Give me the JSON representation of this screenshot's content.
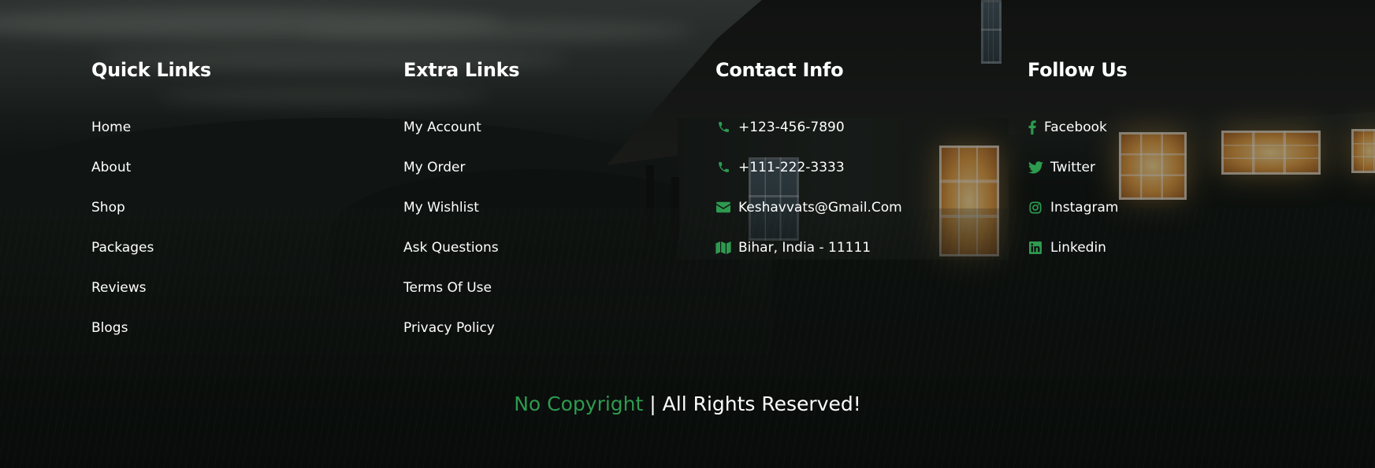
{
  "footer": {
    "quick_links": {
      "title": "Quick Links",
      "items": [
        "Home",
        "About",
        "Shop",
        "Packages",
        "Reviews",
        "Blogs"
      ]
    },
    "extra_links": {
      "title": "Extra Links",
      "items": [
        "My Account",
        "My Order",
        "My Wishlist",
        "Ask Questions",
        "Terms Of Use",
        "Privacy Policy"
      ]
    },
    "contact_info": {
      "title": "Contact Info",
      "items": [
        {
          "icon": "phone-icon",
          "text": "+123-456-7890"
        },
        {
          "icon": "phone-icon",
          "text": "+111-222-3333"
        },
        {
          "icon": "envelope-icon",
          "text": "Keshavvats@Gmail.Com"
        },
        {
          "icon": "map-icon",
          "text": "Bihar, India - 11111"
        }
      ]
    },
    "follow_us": {
      "title": "Follow Us",
      "items": [
        {
          "icon": "facebook-icon",
          "text": "Facebook"
        },
        {
          "icon": "twitter-icon",
          "text": "Twitter"
        },
        {
          "icon": "instagram-icon",
          "text": "Instagram"
        },
        {
          "icon": "linkedin-icon",
          "text": "Linkedin"
        }
      ]
    },
    "copyright": {
      "accent": "No Copyright",
      "rest": " | All Rights Reserved!"
    }
  },
  "colors": {
    "accent": "#2e9a4f",
    "text": "#ffffff",
    "overlay": "rgba(0,0,0,0.38)"
  }
}
